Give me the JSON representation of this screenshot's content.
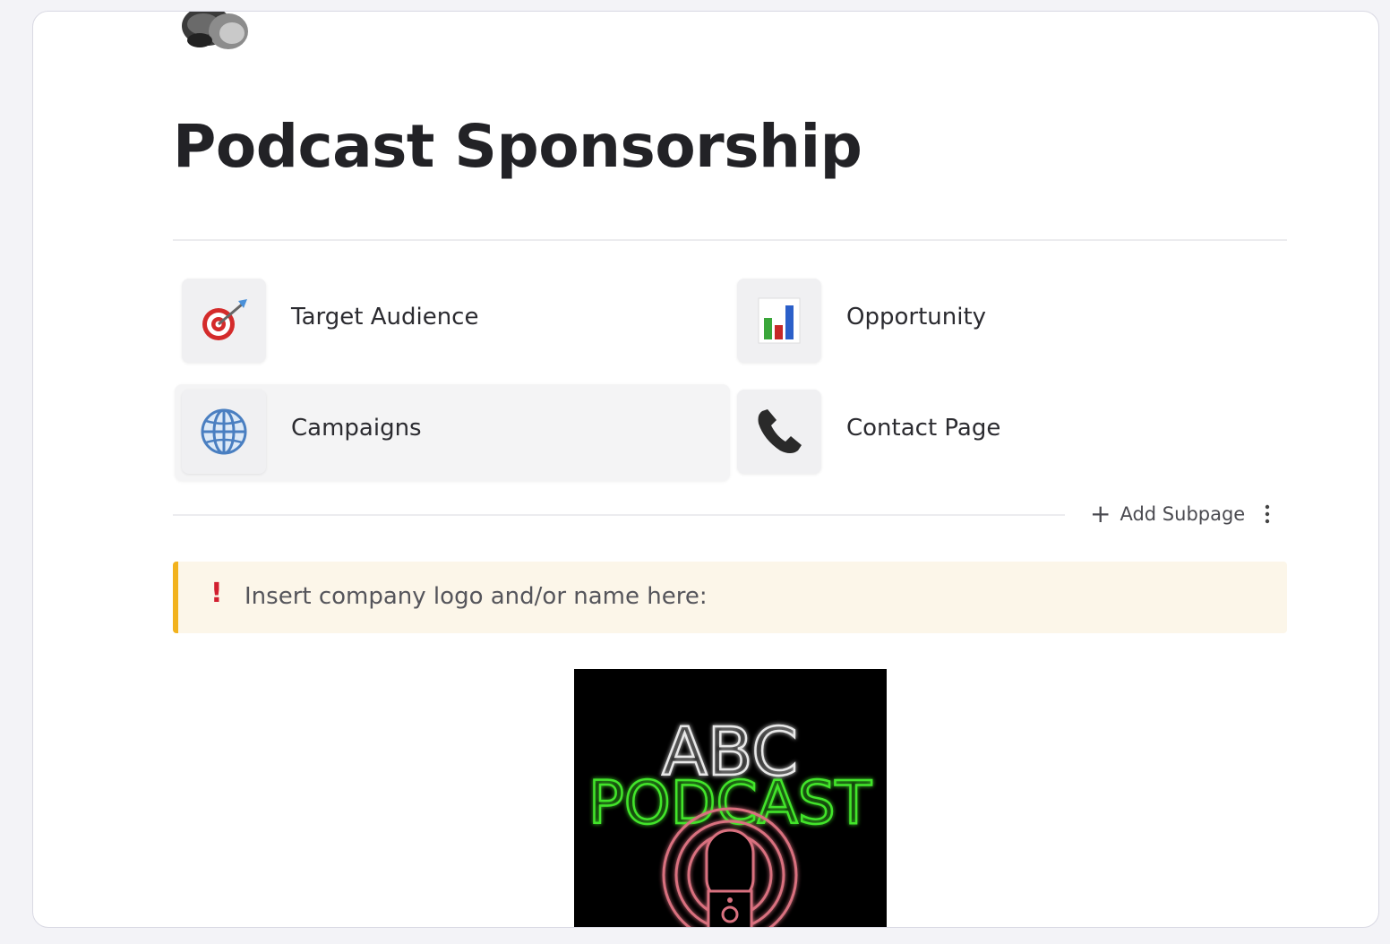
{
  "page": {
    "icon": "megaphone-icon",
    "title": "Podcast Sponsorship"
  },
  "subpages": [
    {
      "label": "Target Audience",
      "icon": "target-icon"
    },
    {
      "label": "Opportunity",
      "icon": "bar-chart-icon"
    },
    {
      "label": "Campaigns",
      "icon": "globe-icon"
    },
    {
      "label": "Contact Page",
      "icon": "phone-icon"
    }
  ],
  "actions": {
    "add_subpage": "Add Subpage",
    "more_icon": "kebab-menu-icon"
  },
  "callout": {
    "icon": "exclamation-icon",
    "text": "Insert company logo and/or name here:",
    "accent_color": "#f2b21d",
    "background": "#fcf6e9"
  },
  "logo": {
    "line1": "ABC",
    "line2": "PODCAST"
  }
}
